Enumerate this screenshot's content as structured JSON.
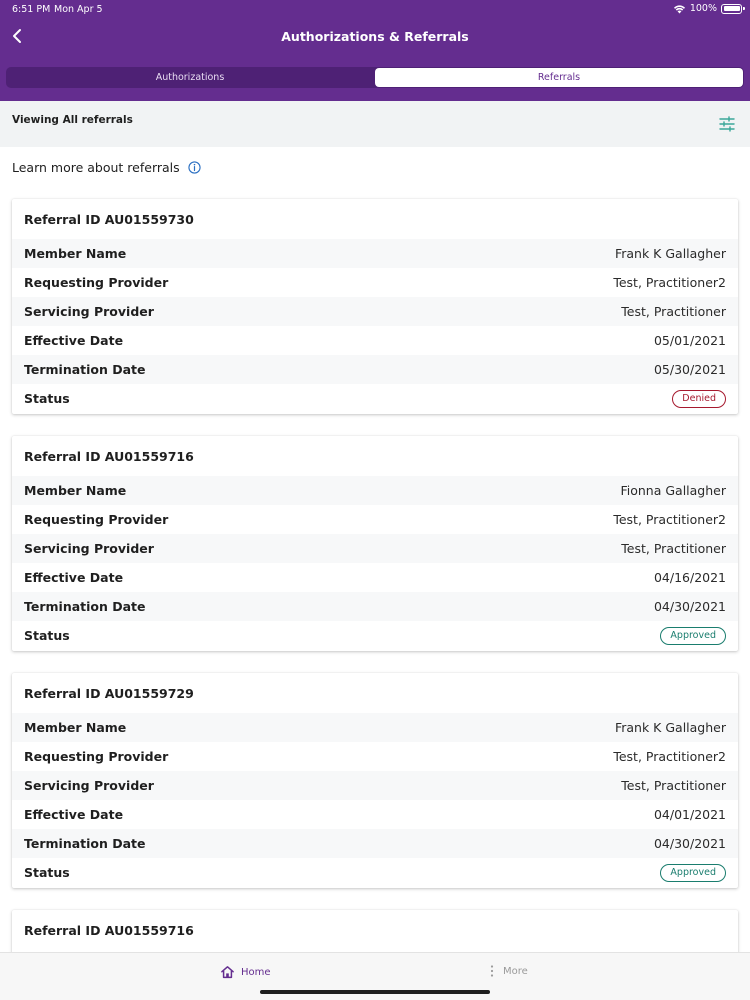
{
  "status_bar": {
    "time": "6:51 PM",
    "date": "Mon Apr 5",
    "battery": "100%"
  },
  "header": {
    "title": "Authorizations & Referrals"
  },
  "tabs": [
    {
      "label": "Authorizations",
      "active": false
    },
    {
      "label": "Referrals",
      "active": true
    }
  ],
  "filter": {
    "label": "Viewing All referrals"
  },
  "learn_more": {
    "label": "Learn more about referrals"
  },
  "field_labels": {
    "member_name": "Member Name",
    "requesting_provider": "Requesting Provider",
    "servicing_provider": "Servicing Provider",
    "effective_date": "Effective Date",
    "termination_date": "Termination Date",
    "status": "Status"
  },
  "referrals": [
    {
      "title": "Referral ID AU01559730",
      "member_name": "Frank K Gallagher",
      "requesting_provider": "Test, Practitioner2",
      "servicing_provider": "Test, Practitioner",
      "effective_date": "05/01/2021",
      "termination_date": "05/30/2021",
      "status": "Denied"
    },
    {
      "title": "Referral ID AU01559716",
      "member_name": "Fionna Gallagher",
      "requesting_provider": "Test, Practitioner2",
      "servicing_provider": "Test, Practitioner",
      "effective_date": "04/16/2021",
      "termination_date": "04/30/2021",
      "status": "Approved"
    },
    {
      "title": "Referral ID AU01559729",
      "member_name": "Frank K Gallagher",
      "requesting_provider": "Test, Practitioner2",
      "servicing_provider": "Test, Practitioner",
      "effective_date": "04/01/2021",
      "termination_date": "04/30/2021",
      "status": "Approved"
    },
    {
      "title": "Referral ID AU01559716"
    }
  ],
  "bottom_nav": {
    "home": "Home",
    "more": "More"
  },
  "colors": {
    "brand_purple": "#642d8f",
    "denied": "#a6192e",
    "approved": "#1a7d6e",
    "info_blue": "#2a6fc2"
  }
}
